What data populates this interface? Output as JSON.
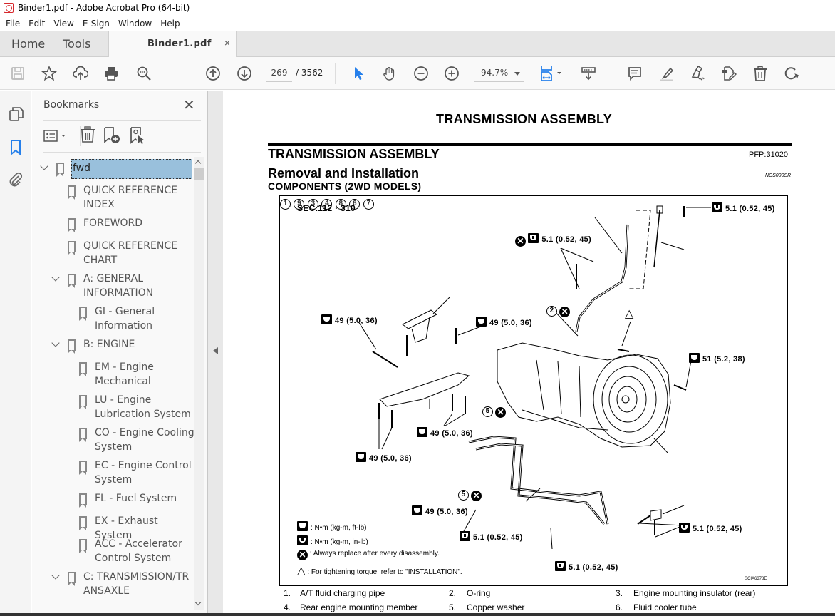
{
  "window": {
    "title": "Binder1.pdf - Adobe Acrobat Pro (64-bit)"
  },
  "menu": [
    "File",
    "Edit",
    "View",
    "E-Sign",
    "Window",
    "Help"
  ],
  "tabs": {
    "home": "Home",
    "tools": "Tools",
    "document": "Binder1.pdf",
    "close_symbol": "×"
  },
  "toolbar": {
    "icons": [
      "save-icon",
      "star-icon",
      "upload-cloud-icon",
      "print-icon",
      "search-zoom-icon",
      "previous-page-icon",
      "next-page-icon",
      "select-cursor-icon",
      "hand-icon",
      "zoom-out-icon",
      "zoom-in-icon",
      "fit-page-icon",
      "scroll-mode-icon",
      "comment-icon",
      "highlight-icon",
      "sign-icon",
      "edit-pdf-icon",
      "delete-icon",
      "rotate-icon"
    ],
    "current_page": "269",
    "total_pages": "/ 3562",
    "zoom": "94.7%",
    "accent": "#2680eb"
  },
  "bookmarks": {
    "title": "Bookmarks",
    "close_symbol": "✕",
    "items": [
      {
        "label": "fwd",
        "level": 0,
        "expanded": true,
        "selected": true
      },
      {
        "label": "QUICK REFERENCE INDEX",
        "level": 1
      },
      {
        "label": "FOREWORD",
        "level": 1
      },
      {
        "label": "QUICK REFERENCE CHART",
        "level": 1
      },
      {
        "label": "A: GENERAL INFORMATION",
        "level": 1,
        "expanded": true
      },
      {
        "label": "GI - General Information",
        "level": 2
      },
      {
        "label": "B: ENGINE",
        "level": 1,
        "expanded": true
      },
      {
        "label": "EM - Engine Mechanical",
        "level": 2
      },
      {
        "label": "LU - Engine Lubrication System",
        "level": 2
      },
      {
        "label": "CO - Engine Cooling System",
        "level": 2
      },
      {
        "label": "EC - Engine Control System",
        "level": 2
      },
      {
        "label": "FL - Fuel System",
        "level": 2
      },
      {
        "label": "EX - Exhaust System",
        "level": 2
      },
      {
        "label": "ACC - Accelerator Control System",
        "level": 2
      },
      {
        "label": "C: TRANSMISSION/TRANSAXLE",
        "level": 1,
        "expanded": true
      }
    ],
    "selected_color": "#99c0dc"
  },
  "document": {
    "page_header": "TRANSMISSION ASSEMBLY",
    "section_title": "TRANSMISSION ASSEMBLY",
    "pfp": "PFP:31020",
    "subtitle": "Removal and Installation",
    "ncs": "NCS000SR",
    "components": "COMPONENTS (2WD MODELS)",
    "figure": {
      "sec": "SEC.112 · 310",
      "code": "SCIA6378E",
      "torque_ft": "49 (5.0, 36)",
      "torque_in": "5.1 (0.52, 45)",
      "torque_51": "51 (5.2, 38)",
      "callouts": [
        "1",
        "2",
        "3",
        "4",
        "5",
        "5",
        "6",
        "7",
        "8",
        "9"
      ],
      "replace_symbol": "✕",
      "legend": [
        ": N•m  (kg-m,  ft-lb)",
        ": N•m  (kg-m,  in-lb)",
        ": Always replace after every disassembly.",
        ": For tightening torque, refer to \"INSTALLATION\"."
      ]
    },
    "parts": [
      {
        "num": "1.",
        "name": "A/T fluid charging pipe"
      },
      {
        "num": "2.",
        "name": "O-ring"
      },
      {
        "num": "3.",
        "name": "Engine mounting insulator (rear)"
      },
      {
        "num": "4.",
        "name": "Rear engine mounting member"
      },
      {
        "num": "5.",
        "name": "Copper washer"
      },
      {
        "num": "6.",
        "name": "Fluid cooler tube"
      }
    ]
  }
}
